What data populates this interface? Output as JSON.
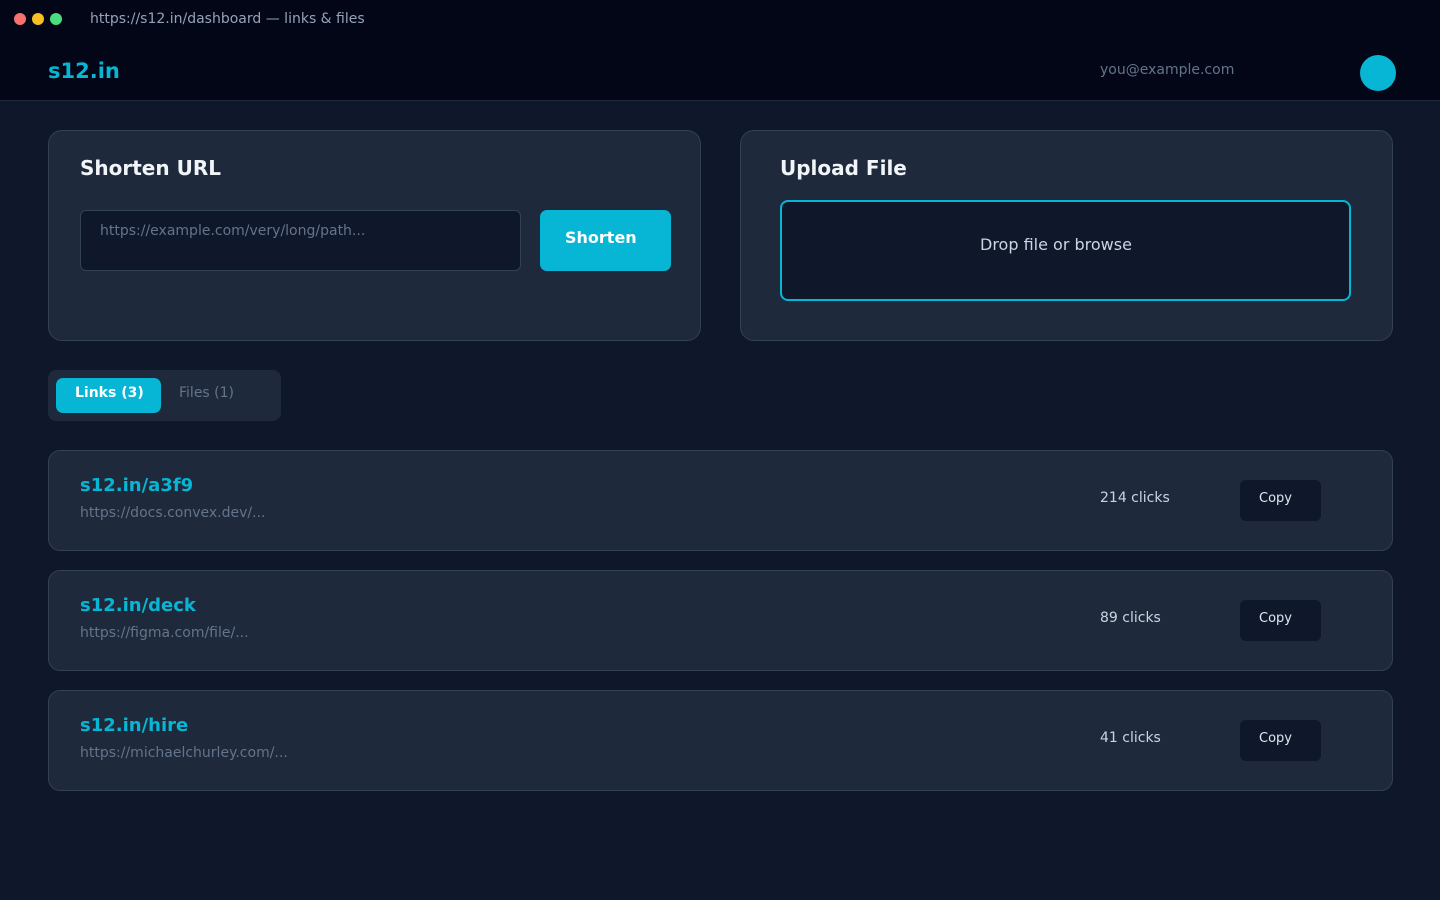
{
  "window": {
    "address": "https://s12.in/dashboard — links & files"
  },
  "header": {
    "logo": "s12.in",
    "user_email": "you@example.com"
  },
  "shorten": {
    "title": "Shorten URL",
    "input_value": "",
    "input_placeholder": "https://example.com/very/long/path...",
    "button_label": "Shorten"
  },
  "upload": {
    "title": "Upload File",
    "dropzone_label": "Drop file or browse"
  },
  "tabs": {
    "links_label": "Links (3)",
    "files_label": "Files (1)",
    "active": "links"
  },
  "links": [
    {
      "short": "s12.in/a3f9",
      "long": "https://docs.convex.dev/...",
      "clicks": "214 clicks",
      "copy_label": "Copy"
    },
    {
      "short": "s12.in/deck",
      "long": "https://figma.com/file/...",
      "clicks": "89 clicks",
      "copy_label": "Copy"
    },
    {
      "short": "s12.in/hire",
      "long": "https://michaelchurley.com/...",
      "clicks": "41 clicks",
      "copy_label": "Copy"
    }
  ],
  "colors": {
    "accent": "#06b6d4",
    "background": "#0f172a",
    "surface": "#1e293b",
    "header": "#020617"
  }
}
